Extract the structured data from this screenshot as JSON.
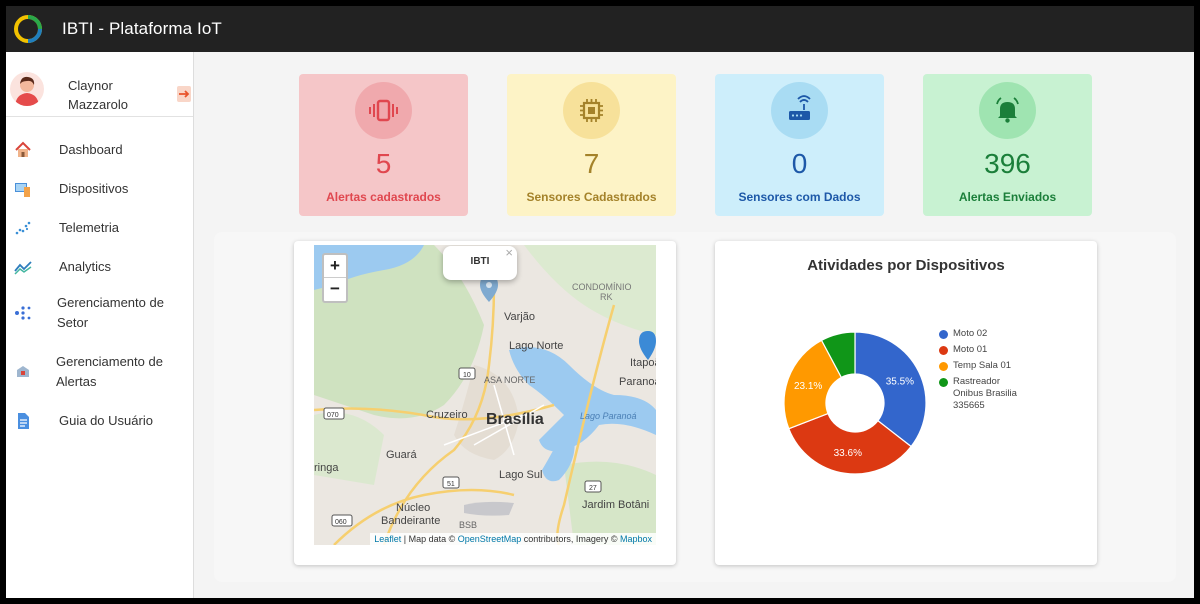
{
  "app": {
    "title": "IBTI - Plataforma IoT"
  },
  "user": {
    "name": "Claynor Mazzarolo"
  },
  "nav": [
    {
      "label": "Dashboard",
      "icon": "home-icon"
    },
    {
      "label": "Dispositivos",
      "icon": "devices-icon"
    },
    {
      "label": "Telemetria",
      "icon": "telemetry-icon"
    },
    {
      "label": "Analytics",
      "icon": "analytics-icon"
    },
    {
      "label": "Gerenciamento de Setor",
      "icon": "sector-icon"
    },
    {
      "label": "Gerenciamento de Alertas",
      "icon": "alert-management-icon"
    },
    {
      "label": "Guia do Usuário",
      "icon": "guide-icon"
    }
  ],
  "stats": [
    {
      "value": "5",
      "label": "Alertas cadastrados",
      "icon": "vibration-icon",
      "bg": "#f5c6c8",
      "circle": "#f0a9ad",
      "color": "#e0474f"
    },
    {
      "value": "7",
      "label": "Sensores Cadastrados",
      "icon": "chip-icon",
      "bg": "#fdf3c6",
      "circle": "#f7e19a",
      "color": "#a4822a"
    },
    {
      "value": "0",
      "label": "Sensores com Dados",
      "icon": "router-icon",
      "bg": "#cdeefb",
      "circle": "#a9dcf3",
      "color": "#1d58a8"
    },
    {
      "value": "396",
      "label": "Alertas Enviados",
      "icon": "bell-icon",
      "bg": "#c8f2d2",
      "circle": "#9fe4b1",
      "color": "#1b7f3a"
    }
  ],
  "map": {
    "popup_label": "IBTI",
    "zoom_in": "+",
    "zoom_out": "−",
    "close": "×",
    "attribution": {
      "leaflet": "Leaflet",
      "mid": " | Map data © ",
      "osm": "OpenStreetMap",
      "mid2": " contributors, Imagery © ",
      "mapbox": "Mapbox"
    },
    "places": {
      "condominio": "CONDOMÍNIO",
      "rk": "RK",
      "varjao": "Varjão",
      "lago_norte": "Lago Norte",
      "asa_norte": "ASA NORTE",
      "itapoa": "Itapoã",
      "paranoa": "Paranoá",
      "cruzeiro": "Cruzeiro",
      "brasilia": "Brasília",
      "lago_paranoa": "Lago Paranoá",
      "guara": "Guará",
      "lago_sul": "Lago Sul",
      "ringa": "ringa",
      "nucleo_1": "Núcleo",
      "nucleo_2": "Bandeirante",
      "jardim_botanico": "Jardim Botâni",
      "bsb": "BSB",
      "r070": "070",
      "r010": "10",
      "r051": "51",
      "r027": "27",
      "r060": "060"
    }
  },
  "chart_data": {
    "type": "pie",
    "title": "Atividades por Dispositivos",
    "donut": true,
    "legend_position": "right",
    "series": [
      {
        "name": "Moto 02",
        "value": 35.5,
        "label": "35.5%",
        "color": "#3366cc"
      },
      {
        "name": "Moto 01",
        "value": 33.6,
        "label": "33.6%",
        "color": "#dc3912"
      },
      {
        "name": "Temp Sala 01",
        "value": 23.1,
        "label": "23.1%",
        "color": "#ff9900"
      },
      {
        "name": "Rastreador Onibus Brasilia 335665",
        "value": 7.8,
        "label": "",
        "color": "#109618"
      }
    ]
  }
}
